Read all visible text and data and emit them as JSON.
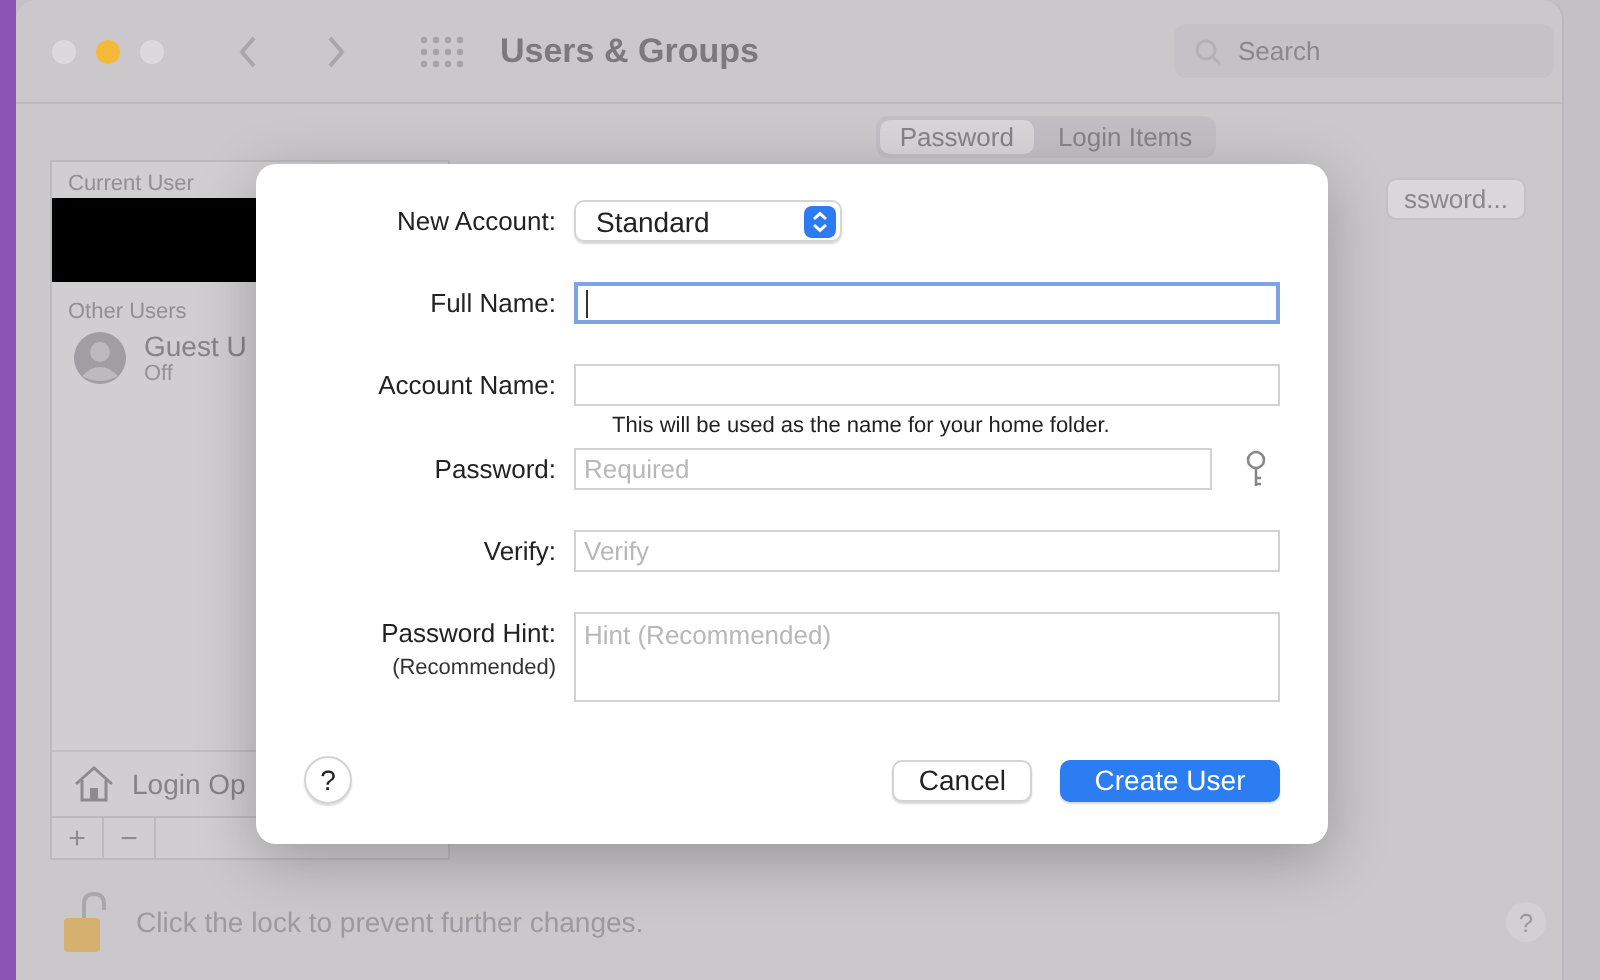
{
  "window": {
    "title": "Users & Groups",
    "search": {
      "placeholder": "Search"
    }
  },
  "sidebar": {
    "sections": [
      {
        "label": "Current User",
        "users": [
          {
            "kind": "redacted"
          }
        ]
      },
      {
        "label": "Other Users",
        "users": [
          {
            "kind": "user",
            "name": "Guest U",
            "status": "Off"
          }
        ]
      }
    ],
    "login_options": "Login Op",
    "buttons": [
      "+",
      "−"
    ]
  },
  "tabs": [
    {
      "label": "Password",
      "selected": true
    },
    {
      "label": "Login Items",
      "selected": false
    }
  ],
  "change_password_button": "ssword...",
  "dialog": {
    "fields": [
      {
        "kind": "popup",
        "label": "New Account:",
        "value": "Standard"
      },
      {
        "kind": "text",
        "label": "Full Name:",
        "focused": true
      },
      {
        "kind": "text",
        "label": "Account Name:",
        "focused": false,
        "note": "This will be used as the name for your home folder."
      },
      {
        "kind": "password",
        "label": "Password:",
        "placeholder": "Required",
        "focused": false
      },
      {
        "kind": "text",
        "label": "Verify:",
        "placeholder": "Verify",
        "focused": false
      },
      {
        "kind": "textarea",
        "label": "Password Hint:",
        "sublabel": "(Recommended)",
        "placeholder": "Hint (Recommended)",
        "focused": false
      }
    ],
    "help": "?",
    "buttons": [
      {
        "label": "Cancel",
        "kind": "secondary"
      },
      {
        "label": "Create User",
        "kind": "primary"
      }
    ]
  },
  "lock_text": "Click the lock to prevent further changes.",
  "help": "?"
}
